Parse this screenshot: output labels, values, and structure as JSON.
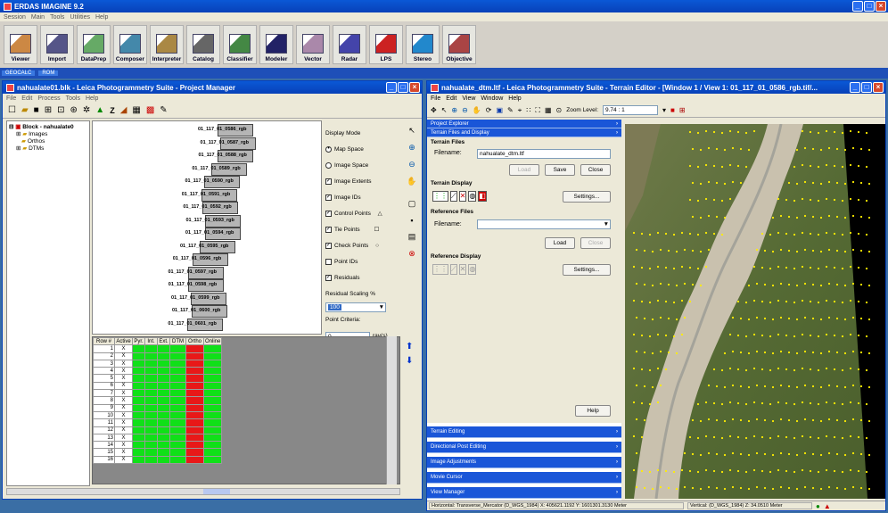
{
  "app": {
    "title": "ERDAS IMAGINE 9.2",
    "menu": [
      "Session",
      "Main",
      "Tools",
      "Utilities",
      "Help"
    ]
  },
  "toolbar": {
    "buttons": [
      "Viewer",
      "Import",
      "DataPrep",
      "Composer",
      "Interpreter",
      "Catalog",
      "Classifier",
      "Modeler",
      "Vector",
      "Radar",
      "LPS",
      "Stereo",
      "Objective"
    ]
  },
  "taskbar": {
    "items": [
      "GEOCALC",
      "ROM"
    ]
  },
  "pm": {
    "title": "nahualate01.blk - Leica Photogrammetry Suite - Project Manager",
    "menu": [
      "File",
      "Edit",
      "Process",
      "Tools",
      "Help"
    ],
    "tree": {
      "root": "Block - nahualate0",
      "children": [
        "Images",
        "Orthos",
        "DTMs"
      ]
    },
    "image_labels": [
      "01_117_01_0586_rgb",
      "01_117_01_0587_rgb",
      "01_117_01_0588_rgb",
      "01_117_01_0589_rgb",
      "01_117_01_0590_rgb",
      "01_117_01_0591_rgb",
      "01_117_01_0592_rgb",
      "01_117_01_0593_rgb",
      "01_117_01_0594_rgb",
      "01_117_01_0595_rgb",
      "01_117_01_0596_rgb",
      "01_117_01_0597_rgb",
      "01_117_01_0598_rgb",
      "01_117_01_0599_rgb",
      "01_117_01_0600_rgb",
      "01_117_01_0601_rgb"
    ],
    "display": {
      "mode_label": "Display Mode",
      "map_space": "Map Space",
      "image_space": "Image Space",
      "options": [
        "Image Extents",
        "Image IDs",
        "Control Points",
        "Tie Points",
        "Check Points",
        "Point IDs",
        "Residuals"
      ],
      "residual_label": "Residual Scaling %",
      "residual_value": "100",
      "point_criteria_label": "Point Criteria:",
      "point_criteria_value": "0",
      "rays_label": "ray(s)"
    },
    "table": {
      "headers": [
        "Row #",
        "Active",
        "Pyr.",
        "Int.",
        "Ext.",
        "DTM",
        "Ortho",
        "Online"
      ],
      "rows": [
        "1",
        "2",
        "3",
        "4",
        "5",
        "6",
        "7",
        "8",
        "9",
        "10",
        "11",
        "12",
        "13",
        "14",
        "15",
        "16"
      ],
      "active_mark": "X"
    }
  },
  "te": {
    "title": "nahualate_dtm.ltf - Leica Photogrammetry Suite - Terrain Editor - [Window 1 / View 1: 01_117_01_0586_rgb.tif/...",
    "menu": [
      "File",
      "Edit",
      "View",
      "Window",
      "Help"
    ],
    "zoom_label": "Zoom Level:",
    "zoom_value": "9.74 : 1",
    "sections": {
      "explorer": "Project Explorer",
      "files_display": "Terrain Files and Display",
      "terrain_files": "Terrain Files",
      "terrain_display": "Terrain Display",
      "reference_files": "Reference Files",
      "reference_display": "Reference Display"
    },
    "filename_label": "Filename:",
    "filename_value": "nahualate_dtm.ltf",
    "ref_filename_label": "Filename:",
    "ref_filename_value": "",
    "buttons": {
      "load": "Load",
      "save": "Save",
      "close": "Close",
      "settings": "Settings...",
      "ref_load": "Load",
      "ref_close": "Close",
      "ref_settings": "Settings...",
      "help": "Help"
    },
    "bottom_sections": [
      "Terrain Editing",
      "Directional Post Editing",
      "Image Adjustments",
      "Movie Cursor",
      "View Manager"
    ],
    "status": {
      "horizontal": "Horizontal: Transverse_Mercator (D_WGS_1984) X: 405621.1192 Y: 1601301.3130 Meter",
      "vertical": "Vertical: (D_WGS_1984) Z: 34.0510 Meter"
    }
  },
  "colors": {
    "title_blue": "#0a58d6",
    "panel_blue": "#1a56d8",
    "status_green": "#10e018",
    "status_red": "#e81818"
  }
}
